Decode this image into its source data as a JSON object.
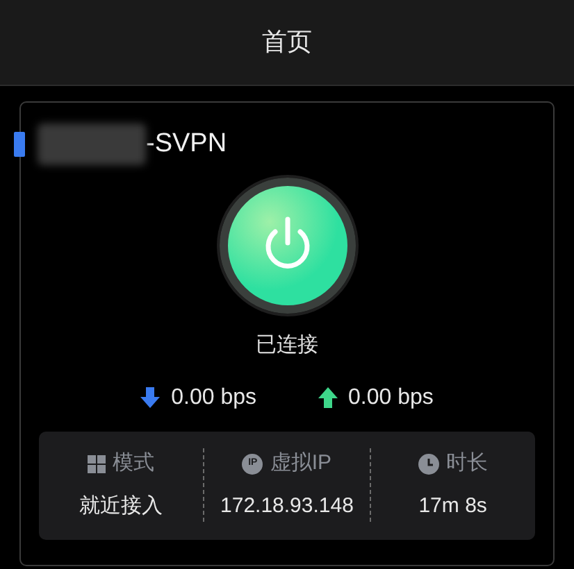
{
  "header": {
    "title": "首页"
  },
  "server": {
    "name_suffix": "-SVPN",
    "name_redacted": true
  },
  "power": {
    "connected": true,
    "status": "已连接"
  },
  "speeds": [
    {
      "kind": "download",
      "value": "0.00 bps"
    },
    {
      "kind": "upload",
      "value": "0.00 bps"
    }
  ],
  "stats": [
    {
      "kind": "mode",
      "label": "模式",
      "value": "就近接入"
    },
    {
      "kind": "ip",
      "label": "虚拟IP",
      "icon_text": "IP",
      "value": "172.18.93.148"
    },
    {
      "kind": "duration",
      "label": "时长",
      "value": "17m 8s"
    }
  ]
}
